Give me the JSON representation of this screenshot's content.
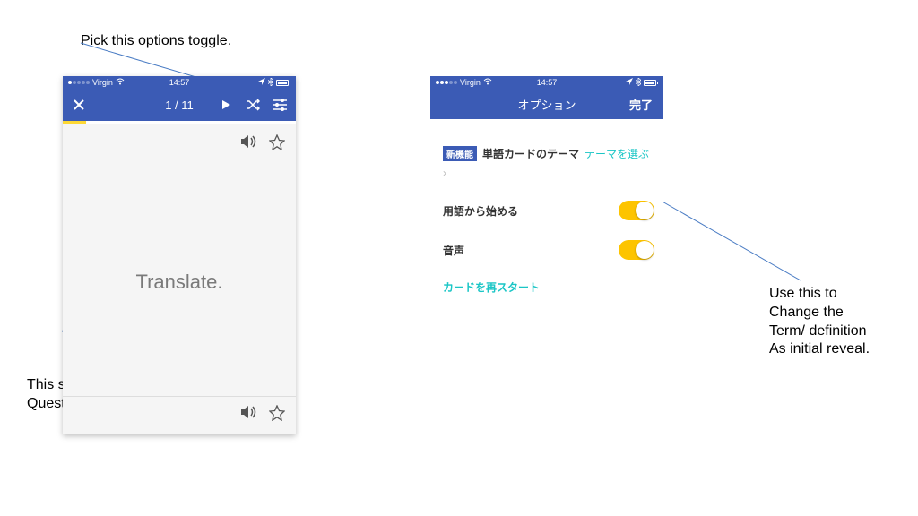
{
  "annotations": {
    "top": "Pick this options toggle.",
    "bottom": "This switches the random\nQuestion selection on/off.",
    "right": "Use this to\nChange the\nTerm/ definition\nAs initial reveal."
  },
  "phone1": {
    "status": {
      "carrier": "Virgin",
      "time": "14:57"
    },
    "nav": {
      "close": "✕",
      "counter": "1 / 11",
      "play": "▶",
      "shuffle": "✕",
      "settings": "≡"
    },
    "card": {
      "main_text": "Translate.",
      "sound_icon": "🔊",
      "star_icon": "☆"
    }
  },
  "phone2": {
    "status": {
      "carrier": "Virgin",
      "time": "14:57"
    },
    "nav": {
      "title": "オプション",
      "done": "完了"
    },
    "options": {
      "new_badge": "新機能",
      "theme_label": "単語カードのテーマ",
      "theme_action": "テーマを選ぶ",
      "start_with_term": "用語から始める",
      "audio": "音声",
      "restart": "カードを再スタート"
    }
  }
}
